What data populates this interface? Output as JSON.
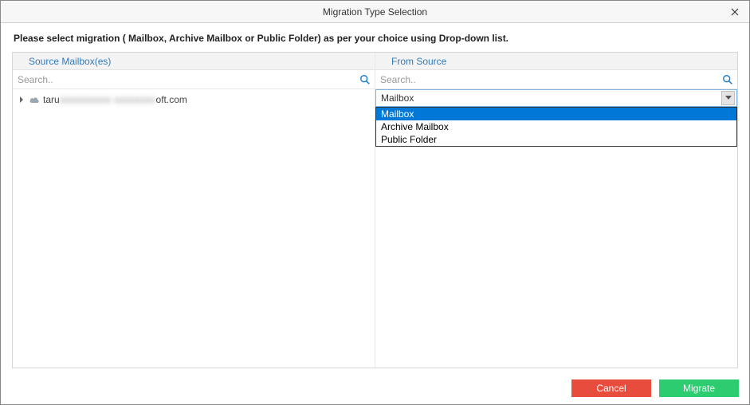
{
  "title": "Migration Type Selection",
  "instruction": "Please select migration ( Mailbox, Archive Mailbox or Public Folder) as per your choice using Drop-down list.",
  "left": {
    "header": "Source Mailbox(es)",
    "search_placeholder": "Search..",
    "tree": {
      "item_prefix": "taru",
      "item_hidden": "xxxxxxxxxx xxxxxxxx",
      "item_suffix": "oft.com"
    }
  },
  "right": {
    "header": "From Source",
    "search_placeholder": "Search..",
    "dropdown": {
      "selected": "Mailbox",
      "options": [
        "Mailbox",
        "Archive Mailbox",
        "Public Folder"
      ]
    }
  },
  "buttons": {
    "cancel": "Cancel",
    "migrate": "Migrate"
  }
}
